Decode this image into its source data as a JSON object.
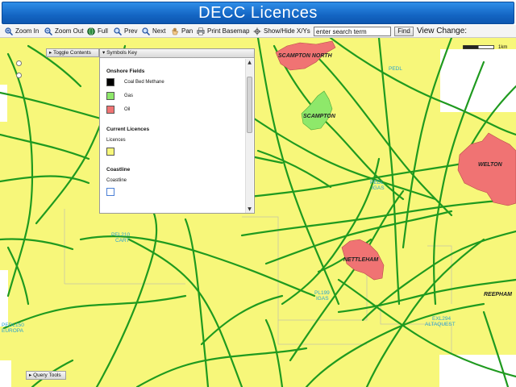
{
  "title": "DECC Licences",
  "toolbar": {
    "zoom_in": "Zoom In",
    "zoom_out": "Zoom Out",
    "full": "Full",
    "prev": "Prev",
    "next": "Next",
    "pan": "Pan",
    "print_basemap": "Print Basemap",
    "show_hide": "Show/Hide X/Ys",
    "search_value": "enter search term",
    "find": "Find",
    "view_change": "View Change:"
  },
  "scalebar": {
    "label": "1km"
  },
  "panels": {
    "toggle_contents": "Toggle Contents",
    "symbols_key": "Symbols Key",
    "query_tools": "Query Tools"
  },
  "legend": {
    "onshore_fields_title": "Onshore Fields",
    "items": [
      {
        "label": "Coal Bed Methane",
        "color": "#000000"
      },
      {
        "label": "Gas",
        "color": "#8ee86a"
      },
      {
        "label": "Oil",
        "color": "#f07373"
      }
    ],
    "current_licences_title": "Current Licences",
    "licences_label": "Licences",
    "licences_color": "#f7f77a",
    "coastline_title": "Coastline",
    "coastline_label": "Coastline",
    "coastline_color": "#4a7fd6"
  },
  "map": {
    "land_color": "#f7f77a",
    "pipeline_color": "#1f9a1f",
    "oil_color": "#f07373",
    "gas_color": "#8ee86a",
    "place_labels": [
      "SCAMPTON NORTH",
      "SCAMPTON",
      "WELTON",
      "NETTLEHAM",
      "REEPHAM"
    ],
    "licence_labels": [
      {
        "line1": "PEL210",
        "line2": "CART"
      },
      {
        "line1": "PL199",
        "line2": "IGAS"
      },
      {
        "line1": "EXL294",
        "line2": "ALTAQUEST"
      },
      {
        "line1": "PEDL150",
        "line2": "EUROPA"
      },
      {
        "line1": "PEDL",
        "line2": "IGAS"
      },
      {
        "line1": "PEDL",
        "line2": ""
      }
    ]
  }
}
